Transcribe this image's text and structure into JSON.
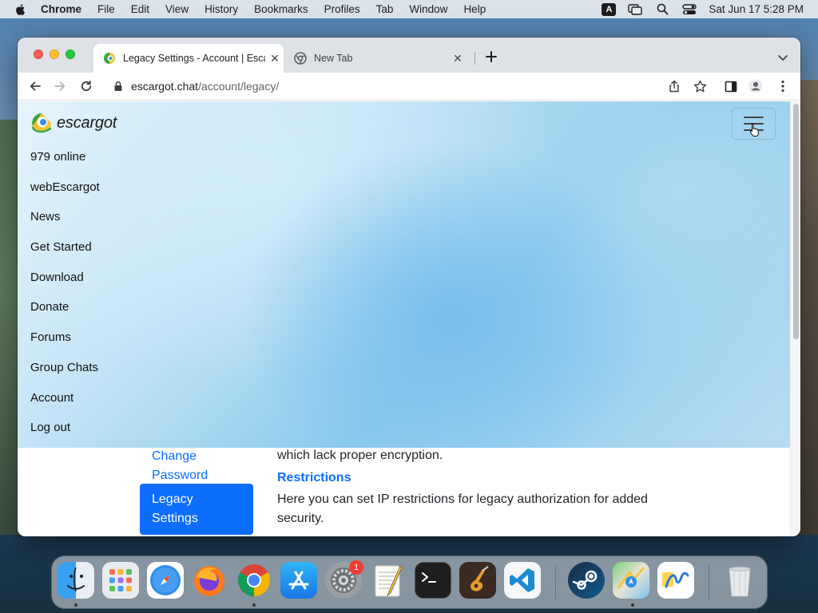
{
  "menubar": {
    "app": "Chrome",
    "items": [
      "File",
      "Edit",
      "View",
      "History",
      "Bookmarks",
      "Profiles",
      "Tab",
      "Window",
      "Help"
    ],
    "input_indicator": "A",
    "datetime": "Sat Jun 17  5:28 PM"
  },
  "tabs": [
    {
      "title": "Legacy Settings - Account | Escargot",
      "active": true
    },
    {
      "title": "New Tab",
      "active": false
    }
  ],
  "omnibox": {
    "host": "escargot.chat",
    "path": "/account/legacy/"
  },
  "site": {
    "brand": "escargot",
    "nav": [
      "979 online",
      "webEscargot",
      "News",
      "Get Started",
      "Download",
      "Donate",
      "Forums",
      "Group Chats",
      "Account",
      "Log out"
    ]
  },
  "sidebar": {
    "change_password": "Change Password",
    "legacy_settings": "Legacy Settings"
  },
  "content": {
    "partial_text": "which lack proper encryption.",
    "heading": "Restrictions",
    "description": "Here you can set IP restrictions for legacy authorization for added security."
  },
  "dock": {
    "apps": [
      "Finder",
      "Launchpad",
      "Safari",
      "Firefox",
      "Google Chrome",
      "App Store",
      "System Preferences",
      "TextEdit",
      "Terminal",
      "GarageBand",
      "Visual Studio Code",
      "Steam",
      "Maps",
      "Freeform",
      "Trash"
    ],
    "system_preferences_badge": "1"
  },
  "colors": {
    "link_blue": "#0d6efd",
    "active_tab": "#ffffff",
    "tabbar": "#dee1e6"
  }
}
